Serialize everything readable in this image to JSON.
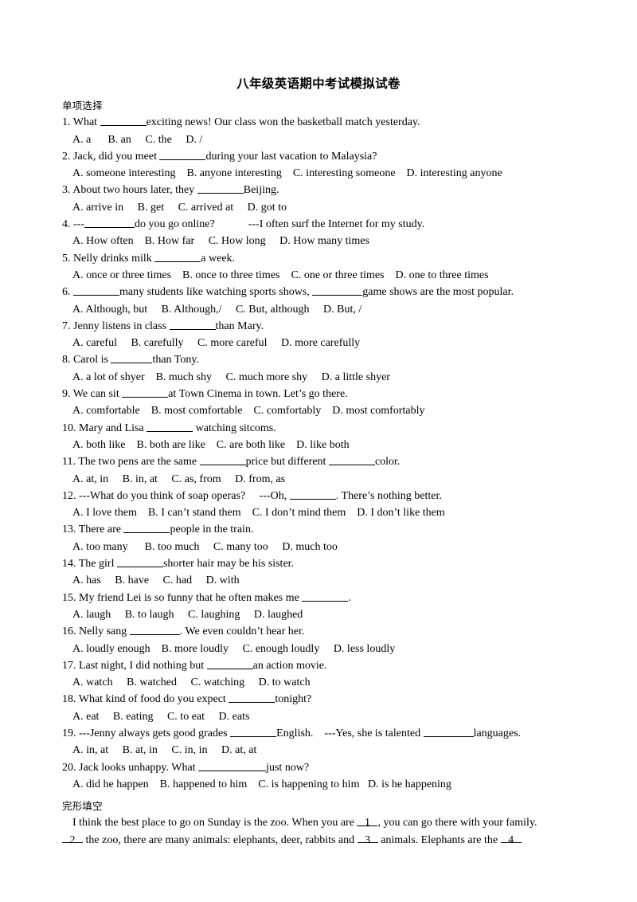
{
  "document": {
    "title": "八年级英语期中考试模拟试卷",
    "sections": [
      {
        "heading": "单项选择",
        "questions": [
          {
            "stem_before": "1. What ",
            "blank_width": 58,
            "stem_after": "exciting news! Our class won the basketball match yesterday.",
            "options": "A. a      B. an     C. the     D. /"
          },
          {
            "stem_before": "2. Jack, did you meet ",
            "blank_width": 58,
            "stem_after": "during your last vacation to Malaysia?",
            "options": "A. someone interesting    B. anyone interesting    C. interesting someone    D. interesting anyone"
          },
          {
            "stem_before": "3. About two hours later, they ",
            "blank_width": 58,
            "stem_after": "Beijing.",
            "options": "A. arrive in     B. get     C. arrived at     D. got to"
          },
          {
            "stem_before": "4. ---",
            "blank_width": 63,
            "stem_after": "do you go online?            ---I often surf the Internet for my study.",
            "options": "A. How often    B. How far     C. How long     D. How many times"
          },
          {
            "stem_before": "5. Nelly drinks milk ",
            "blank_width": 58,
            "stem_after": "a week.",
            "options": "A. once or three times    B. once to three times    C. one or three times    D. one to three times"
          },
          {
            "stem_before": "6. ",
            "blank_width": 58,
            "stem_after": "many students like watching sports shows, ",
            "blank2_width": 63,
            "stem_after2": "game shows are the most popular.",
            "options": "A. Although, but     B. Although,/     C. But, although     D. But, /"
          },
          {
            "stem_before": "7. Jenny listens in class ",
            "blank_width": 58,
            "stem_after": "than Mary.",
            "options": "A. careful     B. carefully     C. more careful     D. more carefully"
          },
          {
            "stem_before": "8. Carol is ",
            "blank_width": 52,
            "stem_after": "than Tony.",
            "options": "A. a lot of shyer    B. much shy     C. much more shy     D. a little shyer"
          },
          {
            "stem_before": "9. We can sit ",
            "blank_width": 58,
            "stem_after": "at Town Cinema in town. Let’s go there.",
            "options": "A. comfortable    B. most comfortable    C. comfortably    D. most comfortably"
          },
          {
            "stem_before": "10. Mary and Lisa ",
            "blank_width": 58,
            "stem_after": " watching sitcoms.",
            "options": "A. both like    B. both are like    C. are both like    D. like both"
          },
          {
            "stem_before": "11. The two pens are the same ",
            "blank_width": 58,
            "stem_after": "price but different ",
            "blank2_width": 58,
            "stem_after2": "color.",
            "options": "A. at, in     B. in, at     C. as, from     D. from, as"
          },
          {
            "stem_before": "12. ---What do you think of soap operas?     ---Oh, ",
            "blank_width": 58,
            "stem_after": ". There’s nothing better.",
            "options": "A. I love them    B. I can’t stand them    C. I don’t mind them    D. I don’t like them"
          },
          {
            "stem_before": "13. There are ",
            "blank_width": 58,
            "stem_after": "people in the train.",
            "options": "A. too many      B. too much     C. many too     D. much too"
          },
          {
            "stem_before": "14. The girl ",
            "blank_width": 58,
            "stem_after": "shorter hair may be his sister.",
            "options": "A. has     B. have     C. had     D. with"
          },
          {
            "stem_before": "15. My friend Lei is so funny that he often makes me ",
            "blank_width": 58,
            "stem_after": ".",
            "options": "A. laugh     B. to laugh     C. laughing     D. laughed"
          },
          {
            "stem_before": "16. Nelly sang ",
            "blank_width": 63,
            "stem_after": ". We even couldn’t hear her.",
            "options": "A. loudly enough    B. more loudly     C. enough loudly     D. less loudly"
          },
          {
            "stem_before": "17. Last night, I did nothing but ",
            "blank_width": 58,
            "stem_after": "an action movie.",
            "options": "A. watch     B. watched     C. watching     D. to watch"
          },
          {
            "stem_before": "18. What kind of food do you expect ",
            "blank_width": 58,
            "stem_after": "tonight?",
            "options": "A. eat     B. eating     C. to eat     D. eats"
          },
          {
            "stem_before": "19. ---Jenny always gets good grades ",
            "blank_width": 58,
            "stem_after": "English.    ---Yes, she is talented ",
            "blank2_width": 63,
            "stem_after2": "languages.",
            "options": "A. in, at     B. at, in     C. in, in     D. at, at"
          },
          {
            "stem_before": "20. Jack looks unhappy. What ",
            "blank_width": 85,
            "stem_after": "just now?",
            "options": "A. did he happen    B. happened to him    C. is happening to him   D. is he happening"
          }
        ]
      }
    ],
    "cloze": {
      "heading": "完形填空",
      "line1_a": "I think the best place to go on Sunday is the zoo. When you are ",
      "line1_blank": "1",
      "line1_b": ", you can go there with your family.",
      "line2_blank": "2",
      "line2_a": " the zoo, there are many animals: elephants, deer, rabbits and ",
      "line2_blank2": "3",
      "line2_b": " animals. Elephants are the ",
      "line2_blank3": "4"
    }
  }
}
